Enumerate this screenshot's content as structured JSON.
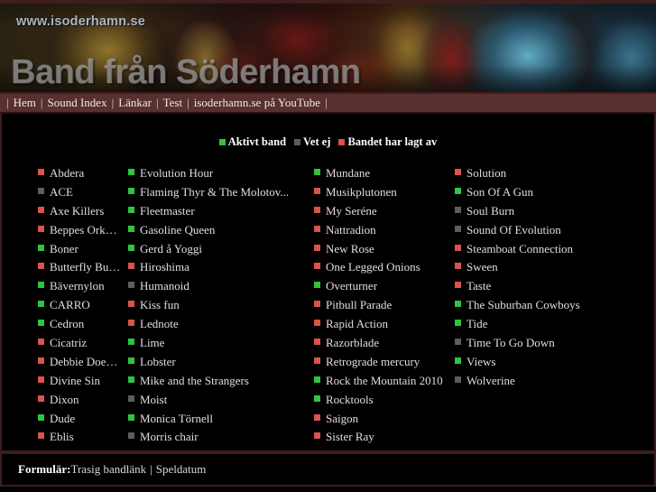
{
  "site": {
    "url_label": "www.isoderhamn.se",
    "title": "Band från Söderhamn"
  },
  "nav": {
    "items": [
      {
        "label": "Hem"
      },
      {
        "label": "Sound Index"
      },
      {
        "label": "Länkar"
      },
      {
        "label": "Test"
      },
      {
        "label": "isoderhamn.se på YouTube"
      }
    ],
    "separator": "|"
  },
  "colors": {
    "active": "#2fc441",
    "unknown": "#5d5d5d",
    "disbanded": "#d9534f",
    "nav_bar": "#57302f",
    "border": "#3f1d1d",
    "background": "#000000",
    "text": "#e3dcd8"
  },
  "legend": {
    "items": [
      {
        "label": "Aktivt band",
        "status": "active"
      },
      {
        "label": "Vet ej",
        "status": "unknown"
      },
      {
        "label": "Bandet har lagt av",
        "status": "disbanded"
      }
    ]
  },
  "columns": [
    {
      "bands": [
        {
          "name": "Abdera",
          "status": "disbanded"
        },
        {
          "name": "ACE",
          "status": "unknown"
        },
        {
          "name": "Axe Killers",
          "status": "disbanded"
        },
        {
          "name": "Beppes Orkester",
          "status": "disbanded"
        },
        {
          "name": "Boner",
          "status": "active"
        },
        {
          "name": "Butterfly Bullets",
          "status": "disbanded"
        },
        {
          "name": "Bävernylon",
          "status": "active"
        },
        {
          "name": "CARRO",
          "status": "active"
        },
        {
          "name": "Cedron",
          "status": "active"
        },
        {
          "name": "Cicatriz",
          "status": "disbanded"
        },
        {
          "name": "Debbie Does Dallas",
          "status": "disbanded"
        },
        {
          "name": "Divine Sin",
          "status": "disbanded"
        },
        {
          "name": "Dixon",
          "status": "disbanded"
        },
        {
          "name": "Dude",
          "status": "active"
        },
        {
          "name": "Eblis",
          "status": "disbanded"
        }
      ]
    },
    {
      "bands": [
        {
          "name": "Evolution Hour",
          "status": "active"
        },
        {
          "name": "Flaming Thyr & The Molotov...",
          "status": "active"
        },
        {
          "name": "Fleetmaster",
          "status": "active"
        },
        {
          "name": "Gasoline Queen",
          "status": "active"
        },
        {
          "name": "Gerd å Yoggi",
          "status": "active"
        },
        {
          "name": "Hiroshima",
          "status": "disbanded"
        },
        {
          "name": "Humanoid",
          "status": "unknown"
        },
        {
          "name": "Kiss fun",
          "status": "disbanded"
        },
        {
          "name": "Lednote",
          "status": "disbanded"
        },
        {
          "name": "Lime",
          "status": "active"
        },
        {
          "name": "Lobster",
          "status": "active"
        },
        {
          "name": "Mike and the Strangers",
          "status": "active"
        },
        {
          "name": "Moist",
          "status": "unknown"
        },
        {
          "name": "Monica Törnell",
          "status": "active"
        },
        {
          "name": "Morris chair",
          "status": "unknown"
        }
      ]
    },
    {
      "bands": [
        {
          "name": "Mundane",
          "status": "active"
        },
        {
          "name": "Musikplutonen",
          "status": "disbanded"
        },
        {
          "name": "My Seréne",
          "status": "disbanded"
        },
        {
          "name": "Nattradion",
          "status": "disbanded"
        },
        {
          "name": "New Rose",
          "status": "disbanded"
        },
        {
          "name": "One Legged Onions",
          "status": "disbanded"
        },
        {
          "name": "Overturner",
          "status": "active"
        },
        {
          "name": "Pitbull Parade",
          "status": "disbanded"
        },
        {
          "name": "Rapid Action",
          "status": "disbanded"
        },
        {
          "name": "Razorblade",
          "status": "disbanded"
        },
        {
          "name": "Retrograde mercury",
          "status": "disbanded"
        },
        {
          "name": "Rock the Mountain 2010",
          "status": "active"
        },
        {
          "name": "Rocktools",
          "status": "active"
        },
        {
          "name": "Saigon",
          "status": "disbanded"
        },
        {
          "name": "Sister Ray",
          "status": "disbanded"
        }
      ]
    },
    {
      "bands": [
        {
          "name": "Solution",
          "status": "disbanded"
        },
        {
          "name": "Son Of A Gun",
          "status": "active"
        },
        {
          "name": "Soul Burn",
          "status": "unknown"
        },
        {
          "name": "Sound Of Evolution",
          "status": "unknown"
        },
        {
          "name": "Steamboat Connection",
          "status": "disbanded"
        },
        {
          "name": "Sween",
          "status": "disbanded"
        },
        {
          "name": "Taste",
          "status": "disbanded"
        },
        {
          "name": "The Suburban Cowboys",
          "status": "active"
        },
        {
          "name": "Tide",
          "status": "active"
        },
        {
          "name": "Time To Go Down",
          "status": "unknown"
        },
        {
          "name": "Views",
          "status": "active"
        },
        {
          "name": "Wolverine",
          "status": "unknown"
        }
      ]
    }
  ],
  "footer": {
    "label": "Formulär:",
    "links": [
      {
        "label": "Trasig bandlänk"
      },
      {
        "label": "Speldatum"
      }
    ],
    "separator": "|"
  }
}
